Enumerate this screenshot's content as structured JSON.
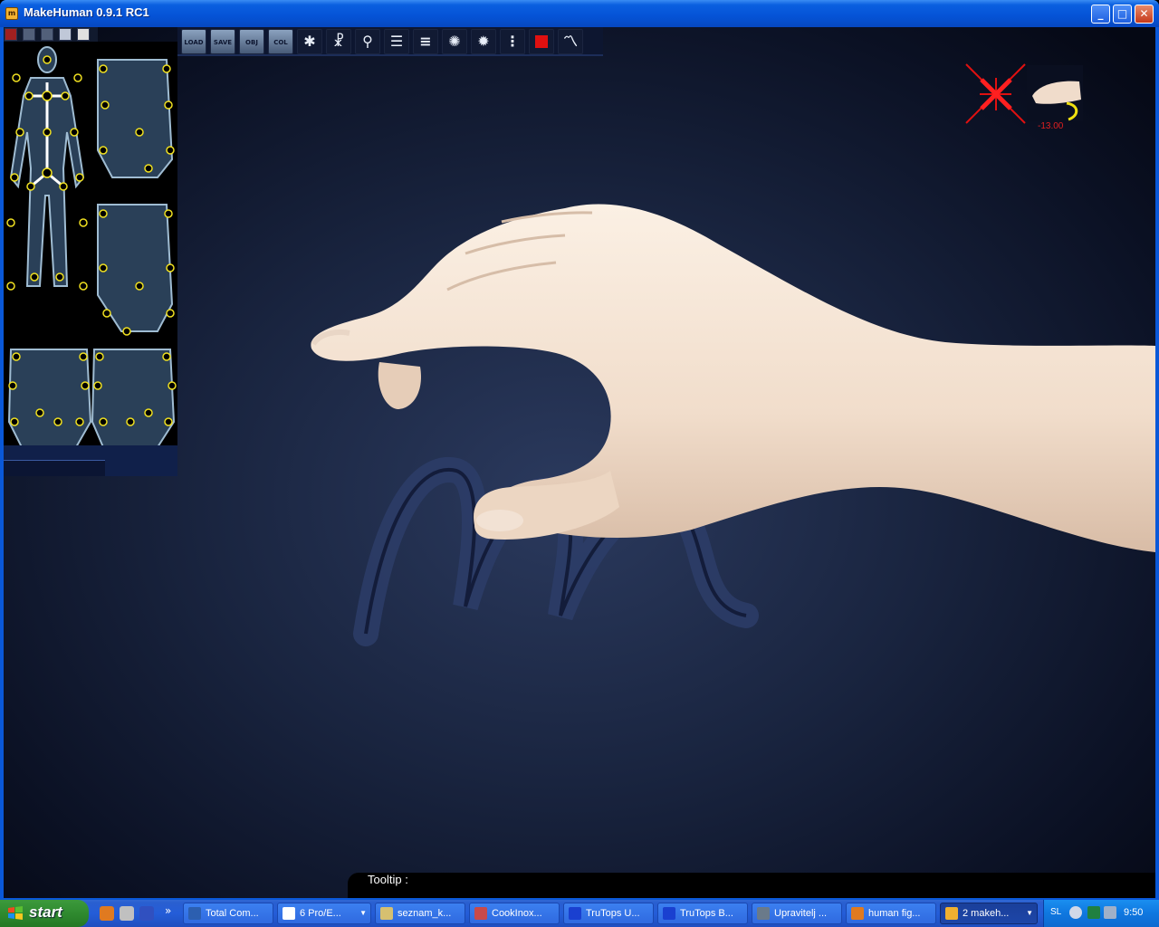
{
  "window": {
    "title": "MakeHuman 0.9.1 RC1",
    "controls": {
      "minimize": "_",
      "maximize": "□",
      "close": "✕"
    }
  },
  "toolbar": {
    "buttons": [
      {
        "name": "load-button",
        "label": "LOAD",
        "icon": "disk-icon"
      },
      {
        "name": "save-button",
        "label": "SAVE",
        "icon": "disk-icon"
      },
      {
        "name": "obj-button",
        "label": "OBJ",
        "icon": "disk-icon"
      },
      {
        "name": "col-button",
        "label": "COL",
        "icon": "disk-icon"
      },
      {
        "name": "body-pose-button",
        "label": "",
        "icon": "figure-icon"
      },
      {
        "name": "skeleton-button",
        "label": "",
        "icon": "skeleton-icon"
      },
      {
        "name": "walk-pose-button",
        "label": "",
        "icon": "walking-figure-icon"
      },
      {
        "name": "list-view-button",
        "label": "",
        "icon": "list-icon"
      },
      {
        "name": "bullet-list-button",
        "label": "",
        "icon": "bullet-list-icon"
      },
      {
        "name": "splash-button",
        "label": "",
        "icon": "splash-icon"
      },
      {
        "name": "splash-small-button",
        "label": "",
        "icon": "splash-small-icon"
      },
      {
        "name": "dotted-list-button",
        "label": "",
        "icon": "dotted-list-icon"
      },
      {
        "name": "stop-button",
        "label": "",
        "icon": "stop-icon"
      },
      {
        "name": "graph-button",
        "label": "",
        "icon": "graph-icon"
      }
    ]
  },
  "hand_widget": {
    "value": "-13.00"
  },
  "tooltip": {
    "label": "Tooltip :"
  },
  "taskbar": {
    "start_label": "start",
    "tasks": [
      {
        "label": "Total Com...",
        "icon_color": "#2c5fb0",
        "arrow": false
      },
      {
        "label": "6 Pro/E...",
        "icon_color": "#ffffff",
        "arrow": true
      },
      {
        "label": "seznam_k...",
        "icon_color": "#d6c070",
        "arrow": false
      },
      {
        "label": "CookInox...",
        "icon_color": "#c84a4a",
        "arrow": false
      },
      {
        "label": "TruTops U...",
        "icon_color": "#1a40d0",
        "arrow": false
      },
      {
        "label": "TruTops B...",
        "icon_color": "#1a40d0",
        "arrow": false
      },
      {
        "label": "Upravitelj ...",
        "icon_color": "#6a7a8a",
        "arrow": false
      },
      {
        "label": "human fig...",
        "icon_color": "#e07a20",
        "arrow": false
      },
      {
        "label": "2 makeh...",
        "icon_color": "#f0b030",
        "arrow": true,
        "active": true
      }
    ],
    "tray": {
      "language": "SL",
      "clock": "9:50"
    }
  }
}
